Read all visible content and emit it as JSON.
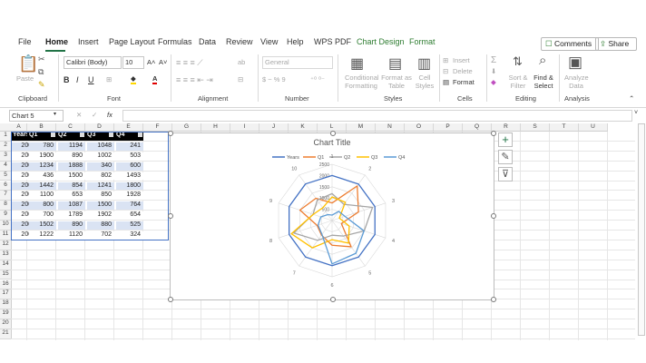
{
  "tabs": [
    "File",
    "Home",
    "Insert",
    "Page Layout",
    "Formulas",
    "Data",
    "Review",
    "View",
    "Help",
    "WPS PDF",
    "Chart Design",
    "Format"
  ],
  "top_buttons": {
    "comments": "Comments",
    "share": "Share"
  },
  "ribbon": {
    "paste": "Paste",
    "font_name": "Calibri (Body)",
    "font_size": "10",
    "bold": "B",
    "italic": "I",
    "underline": "U",
    "number_format": "General",
    "currency": "$ ~ % 9",
    "conditional": "Conditional Formatting",
    "format_table": "Format as Table",
    "cell_styles": "Cell Styles",
    "insert": "Insert",
    "delete": "Delete",
    "format": "Format",
    "sort_filter": "Sort & Filter",
    "find_select": "Find & Select",
    "analyze": "Analyze Data",
    "groups": [
      "Clipboard",
      "Font",
      "Alignment",
      "Number",
      "Styles",
      "Cells",
      "Editing",
      "Analysis"
    ]
  },
  "formula_bar": {
    "name_box": "Chart 5",
    "fx": "fx",
    "value": ""
  },
  "sheet": {
    "columns": [
      "A",
      "B",
      "C",
      "D",
      "E",
      "F",
      "G",
      "H",
      "I",
      "J",
      "K",
      "L",
      "M",
      "N",
      "O",
      "P",
      "Q",
      "R",
      "S",
      "T",
      "U"
    ],
    "rows": [
      "1",
      "2",
      "3",
      "4",
      "5",
      "6",
      "7",
      "8",
      "9",
      "10",
      "11",
      "12",
      "13",
      "14",
      "15",
      "16",
      "17",
      "18",
      "19",
      "20",
      "21"
    ],
    "headers": [
      "Years",
      "Q1",
      "Q2",
      "Q3",
      "Q4"
    ],
    "data": [
      [
        "2000",
        "780",
        "1194",
        "1048",
        "241"
      ],
      [
        "2001",
        "1900",
        "890",
        "1002",
        "503"
      ],
      [
        "2002",
        "1234",
        "1888",
        "340",
        "600"
      ],
      [
        "2003",
        "436",
        "1500",
        "802",
        "1493"
      ],
      [
        "2004",
        "1442",
        "854",
        "1241",
        "1800"
      ],
      [
        "2005",
        "1100",
        "653",
        "850",
        "1928"
      ],
      [
        "2006",
        "800",
        "1087",
        "1500",
        "764"
      ],
      [
        "2007",
        "700",
        "1789",
        "1902",
        "654"
      ],
      [
        "2008",
        "1502",
        "890",
        "880",
        "525"
      ],
      [
        "2009",
        "1222",
        "1120",
        "702",
        "324"
      ]
    ]
  },
  "chart_data": {
    "type": "radar",
    "title": "Chart Title",
    "categories": [
      "1",
      "2",
      "3",
      "4",
      "5",
      "6",
      "7",
      "8",
      "9",
      "10"
    ],
    "rmax": 2500,
    "ticks": [
      "500",
      "1000",
      "1500",
      "2000",
      "2500"
    ],
    "legend_position": "top",
    "series": [
      {
        "name": "Years",
        "color": "#4472c4",
        "values": [
          2000,
          2001,
          2002,
          2003,
          2004,
          2005,
          2006,
          2007,
          2008,
          2009
        ]
      },
      {
        "name": "Q1",
        "color": "#ed7d31",
        "values": [
          780,
          1900,
          1234,
          436,
          1442,
          1100,
          800,
          700,
          1502,
          1222
        ]
      },
      {
        "name": "Q2",
        "color": "#a5a5a5",
        "values": [
          1194,
          890,
          1888,
          1500,
          854,
          653,
          1087,
          1789,
          890,
          1120
        ]
      },
      {
        "name": "Q3",
        "color": "#ffc000",
        "values": [
          1048,
          1002,
          340,
          802,
          1241,
          850,
          1500,
          1902,
          880,
          702
        ]
      },
      {
        "name": "Q4",
        "color": "#5b9bd5",
        "values": [
          241,
          503,
          600,
          1493,
          1800,
          1928,
          764,
          654,
          525,
          324
        ]
      }
    ]
  }
}
